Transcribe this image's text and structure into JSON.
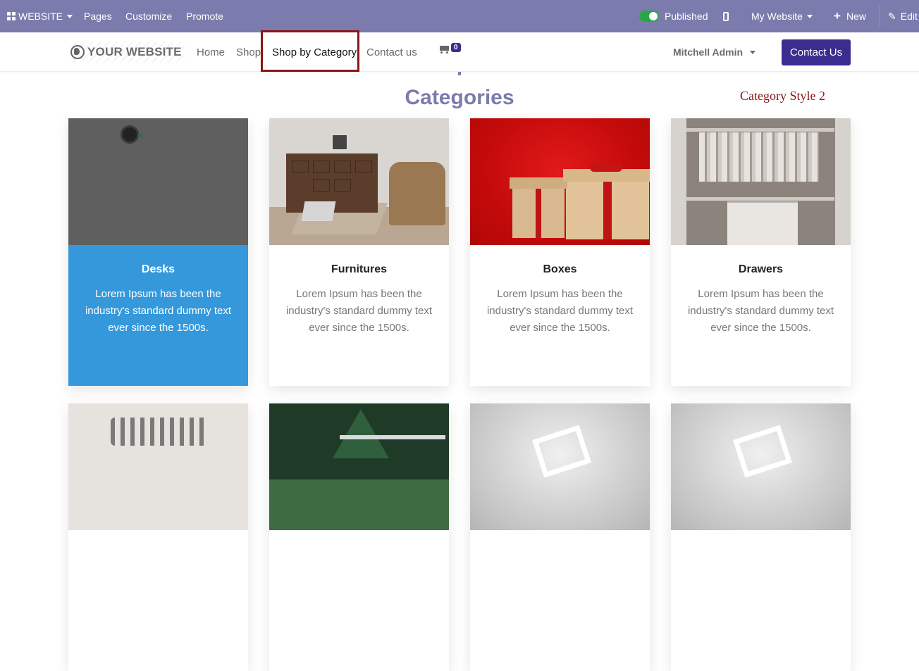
{
  "admin_bar": {
    "app_label": "WEBSITE",
    "menu": [
      "Pages",
      "Customize",
      "Promote"
    ],
    "published_label": "Published",
    "website_selector": "My Website",
    "new_label": "New",
    "edit_label": "Edit"
  },
  "header": {
    "logo_text": "YOUR WEBSITE",
    "nav": [
      "Home",
      "Shop",
      "Shop by Category",
      "Contact us"
    ],
    "active_nav": "Shop by Category",
    "cart_count": "0",
    "user_name": "Mitchell Admin",
    "contact_button": "Contact Us"
  },
  "section": {
    "title": "Categories",
    "style_label": "Category Style 2"
  },
  "categories": [
    {
      "name": "Desks",
      "description": "Lorem Ipsum has been the industry's standard dummy text ever since the 1500s.",
      "featured": true
    },
    {
      "name": "Furnitures",
      "description": "Lorem Ipsum has been the industry's standard dummy text ever since the 1500s."
    },
    {
      "name": "Boxes",
      "description": "Lorem Ipsum has been the industry's standard dummy text ever since the 1500s."
    },
    {
      "name": "Drawers",
      "description": "Lorem Ipsum has been the industry's standard dummy text ever since the 1500s."
    }
  ],
  "colors": {
    "admin_bar": "#7c7bad",
    "primary": "#3b2d8f",
    "featured_card": "#3498db",
    "annotation": "#8b1518",
    "published_toggle": "#28a745"
  }
}
